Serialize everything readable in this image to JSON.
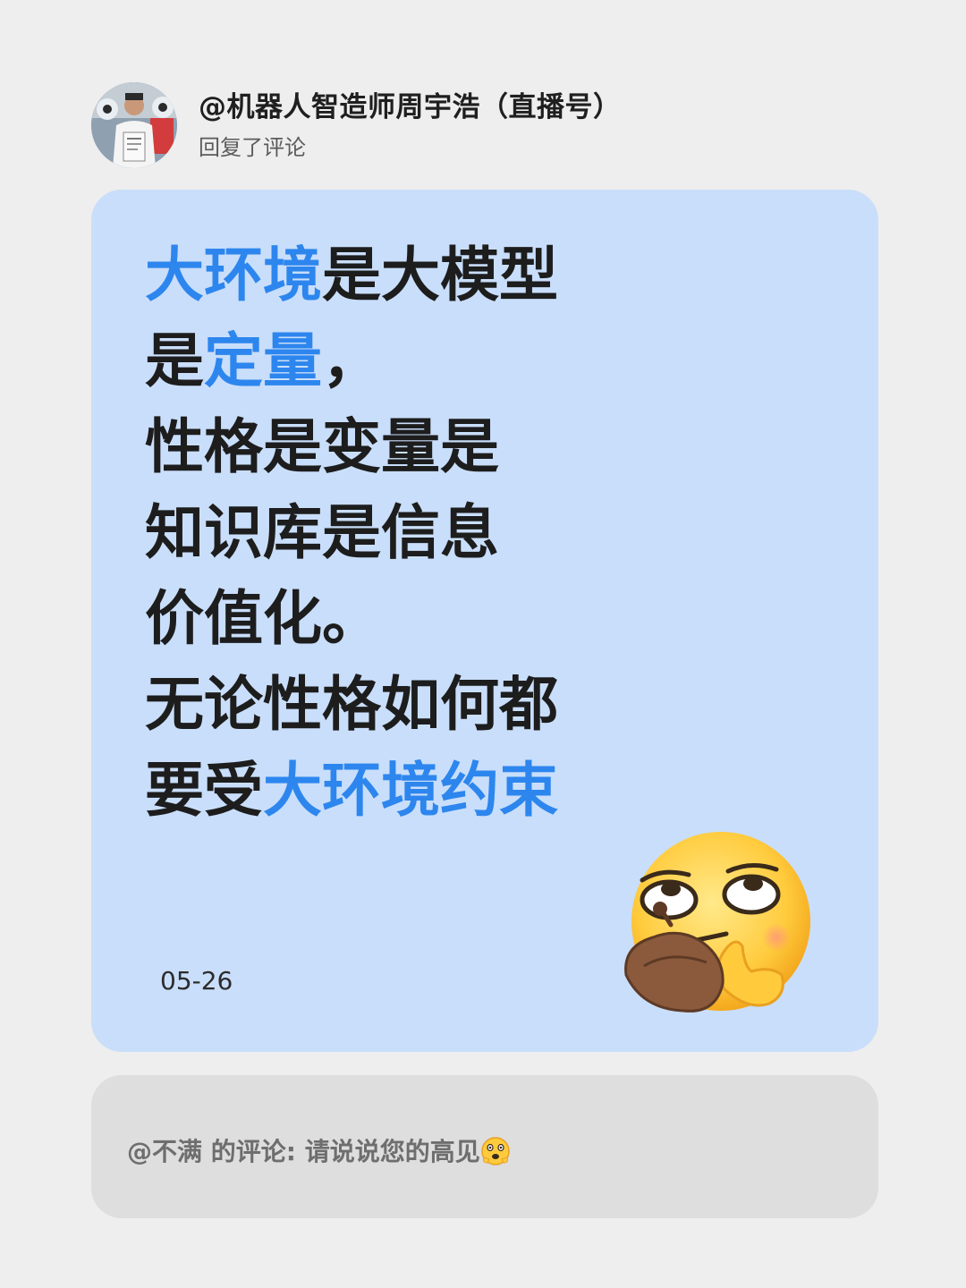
{
  "header": {
    "username": "@机器人智造师周宇浩（直播号）",
    "action": "回复了评论",
    "avatar_icon": "user-avatar"
  },
  "card": {
    "lines": [
      [
        {
          "text": "大环境",
          "highlight": true
        },
        {
          "text": "是大模型",
          "highlight": false
        }
      ],
      [
        {
          "text": "是",
          "highlight": false
        },
        {
          "text": "定量",
          "highlight": true
        },
        {
          "text": "，",
          "highlight": false
        }
      ],
      [
        {
          "text": "性格是变量是",
          "highlight": false
        }
      ],
      [
        {
          "text": "知识库是信息",
          "highlight": false
        }
      ],
      [
        {
          "text": "价值化。",
          "highlight": false
        }
      ],
      [
        {
          "text": "无论性格如何都",
          "highlight": false
        }
      ],
      [
        {
          "text": "要受",
          "highlight": false
        },
        {
          "text": "大环境约束",
          "highlight": true
        }
      ]
    ],
    "date": "05-26",
    "emoji_icon": "thinking-face-emoji"
  },
  "comment": {
    "user": "@不满",
    "label": "的评论:",
    "text": "请说说您的高见",
    "emoji_icon": "shocked-face-emoji"
  },
  "colors": {
    "highlight": "#2d86ee",
    "card_bg": "#c9defa",
    "comment_bg": "#dedede",
    "page_bg": "#eeeeee"
  }
}
